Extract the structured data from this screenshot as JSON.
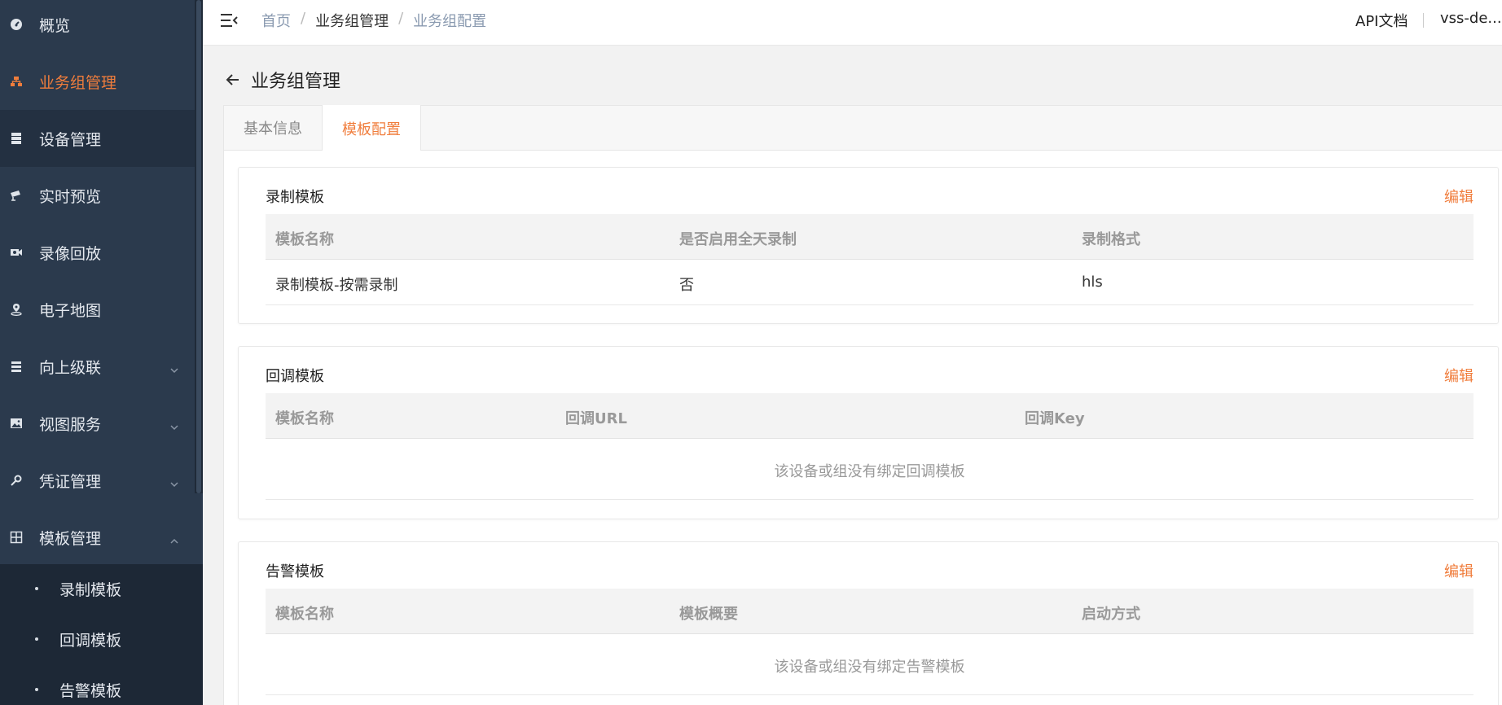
{
  "sidebar": {
    "items": [
      {
        "label": "概览",
        "icon": "dashboard-icon"
      },
      {
        "label": "业务组管理",
        "icon": "org-icon"
      },
      {
        "label": "设备管理",
        "icon": "server-icon"
      },
      {
        "label": "实时预览",
        "icon": "camera-icon"
      },
      {
        "label": "录像回放",
        "icon": "video-icon"
      },
      {
        "label": "电子地图",
        "icon": "map-pin-icon"
      },
      {
        "label": "向上级联",
        "icon": "stack-icon"
      },
      {
        "label": "视图服务",
        "icon": "image-icon"
      },
      {
        "label": "凭证管理",
        "icon": "key-icon"
      },
      {
        "label": "模板管理",
        "icon": "grid-icon"
      }
    ],
    "sub_items": [
      {
        "label": "录制模板"
      },
      {
        "label": "回调模板"
      },
      {
        "label": "告警模板"
      }
    ],
    "active_color": "#f07d3c"
  },
  "header": {
    "breadcrumb": {
      "home": "首页",
      "sep": "/",
      "mid": "业务组管理",
      "current": "业务组配置"
    },
    "api_doc": "API文档",
    "user": "vss-de..."
  },
  "page": {
    "title": "业务组管理",
    "tabs": [
      {
        "label": "基本信息"
      },
      {
        "label": "模板配置"
      }
    ]
  },
  "cards": {
    "record": {
      "title": "录制模板",
      "edit": "编辑",
      "columns": [
        "模板名称",
        "是否启用全天录制",
        "录制格式"
      ],
      "rows": [
        [
          "录制模板-按需录制",
          "否",
          "hls"
        ]
      ]
    },
    "callback": {
      "title": "回调模板",
      "edit": "编辑",
      "columns": [
        "模板名称",
        "回调URL",
        "回调Key"
      ],
      "empty": "该设备或组没有绑定回调模板"
    },
    "alarm": {
      "title": "告警模板",
      "edit": "编辑",
      "columns": [
        "模板名称",
        "模板概要",
        "启动方式"
      ],
      "empty": "该设备或组没有绑定告警模板"
    }
  }
}
